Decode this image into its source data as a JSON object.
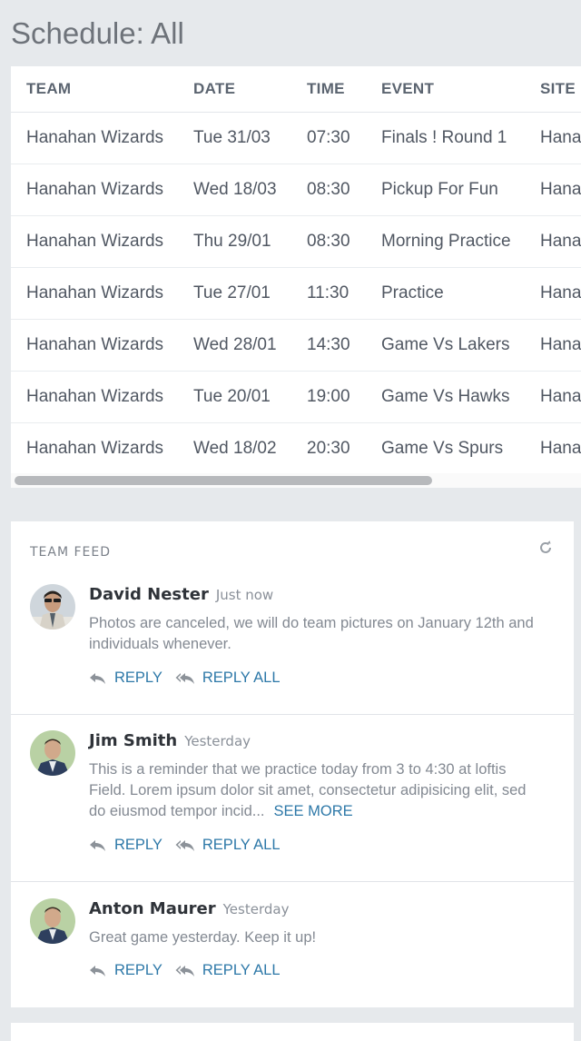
{
  "page": {
    "title": "Schedule: All"
  },
  "schedule": {
    "columns": [
      "TEAM",
      "DATE",
      "TIME",
      "EVENT",
      "SITE"
    ],
    "rows": [
      [
        "Hanahan Wizards",
        "Tue 31/03",
        "07:30",
        "Finals ! Round 1",
        "Hana"
      ],
      [
        "Hanahan Wizards",
        "Wed 18/03",
        "08:30",
        "Pickup For Fun",
        "Hana"
      ],
      [
        "Hanahan Wizards",
        "Thu 29/01",
        "08:30",
        "Morning Practice",
        "Hana"
      ],
      [
        "Hanahan Wizards",
        "Tue 27/01",
        "11:30",
        "Practice",
        "Hana"
      ],
      [
        "Hanahan Wizards",
        "Wed 28/01",
        "14:30",
        "Game Vs Lakers",
        "Hana"
      ],
      [
        "Hanahan Wizards",
        "Tue 20/01",
        "19:00",
        "Game Vs Hawks",
        "Hana"
      ],
      [
        "Hanahan Wizards",
        "Wed 18/02",
        "20:30",
        "Game Vs Spurs",
        "Hana"
      ]
    ]
  },
  "feed": {
    "header": "TEAM FEED",
    "refresh_icon": "refresh-icon",
    "posts": [
      {
        "author": "David Nester",
        "time": "Just now",
        "text": "Photos are canceled, we will do team pictures on January 12th and individuals whenever.",
        "see_more": "",
        "reply": "REPLY",
        "reply_all": "REPLY ALL"
      },
      {
        "author": "Jim Smith",
        "time": "Yesterday",
        "text": "This is a reminder that we practice today from 3 to 4:30 at loftis Field. Lorem ipsum dolor sit amet, consectetur adipisicing elit, sed do eiusmod tempor incid...",
        "see_more": "SEE MORE",
        "reply": "REPLY",
        "reply_all": "REPLY ALL"
      },
      {
        "author": "Anton Maurer",
        "time": "Yesterday",
        "text": "Great game yesterday. Keep it up!",
        "see_more": "",
        "reply": "REPLY",
        "reply_all": "REPLY ALL"
      }
    ]
  },
  "colors": {
    "background": "#e6e9ec",
    "card": "#ffffff",
    "link": "#2d78a8",
    "muted_text": "#838992"
  }
}
